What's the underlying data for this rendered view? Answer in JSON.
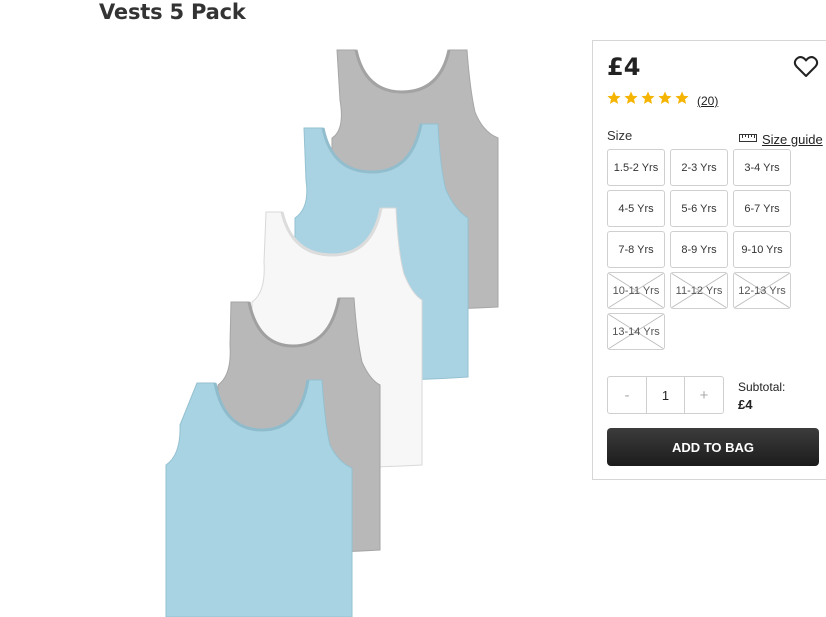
{
  "product": {
    "title": "Vests 5 Pack",
    "image_alt": "product-image-vests-5-pack"
  },
  "panel": {
    "price": "£4",
    "rating": {
      "stars": 5,
      "max": 5,
      "review_count": "(20)",
      "star_color": "#f5b400"
    },
    "size_label": "Size",
    "size_guide_label": "Size guide",
    "sizes": [
      {
        "label": "1.5-2 Yrs",
        "available": true
      },
      {
        "label": "2-3 Yrs",
        "available": true
      },
      {
        "label": "3-4 Yrs",
        "available": true
      },
      {
        "label": "4-5 Yrs",
        "available": true
      },
      {
        "label": "5-6 Yrs",
        "available": true
      },
      {
        "label": "6-7 Yrs",
        "available": true
      },
      {
        "label": "7-8 Yrs",
        "available": true
      },
      {
        "label": "8-9 Yrs",
        "available": true
      },
      {
        "label": "9-10 Yrs",
        "available": true
      },
      {
        "label": "10-11 Yrs",
        "available": false
      },
      {
        "label": "11-12 Yrs",
        "available": false
      },
      {
        "label": "12-13 Yrs",
        "available": false
      },
      {
        "label": "13-14 Yrs",
        "available": false
      }
    ],
    "quantity": {
      "minus_label": "-",
      "plus_label": "+",
      "value": "1"
    },
    "subtotal_label": "Subtotal:",
    "subtotal_value": "£4",
    "add_to_bag_label": "ADD TO BAG"
  },
  "icons": {
    "wishlist": "heart-outline-icon",
    "size_guide": "ruler-icon",
    "star": "star-icon",
    "unavailable": "cross-icon"
  },
  "colors": {
    "button_dark": "#222222",
    "border": "#cfcfcf",
    "vest_grey": "#b8b8b8",
    "vest_blue": "#a9d4e3",
    "vest_white": "#f6f6f6"
  }
}
